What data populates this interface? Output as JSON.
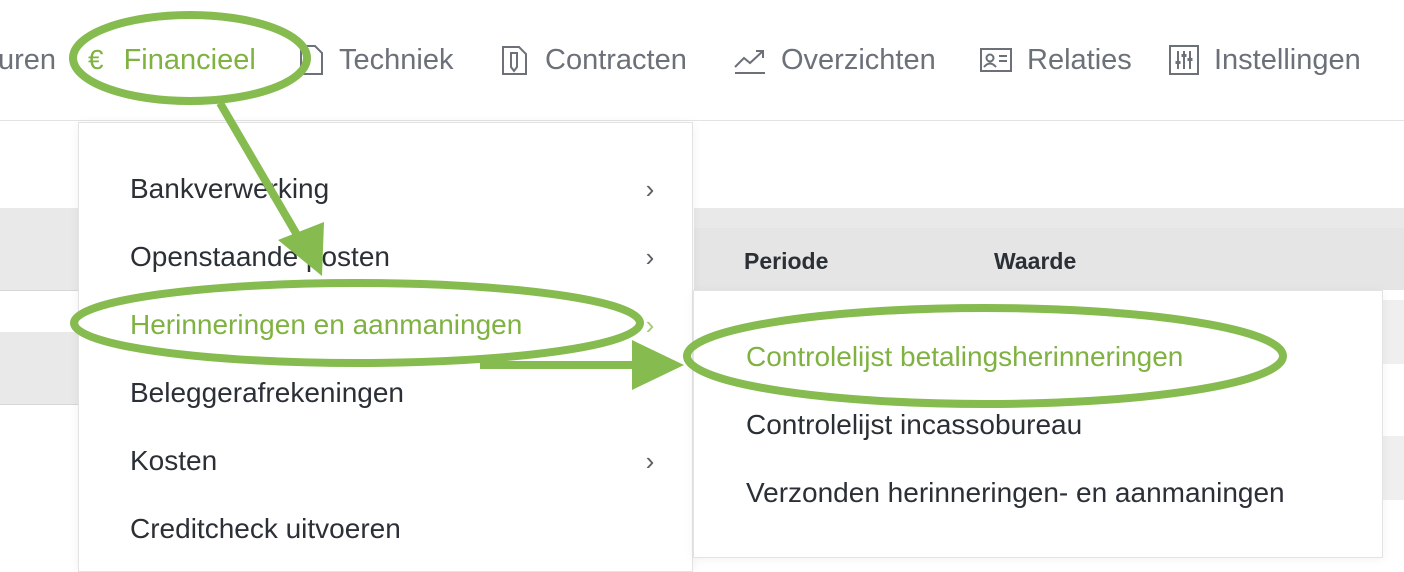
{
  "colors": {
    "accent": "#7fb241",
    "annotation": "#85bb4f",
    "nav_text": "#6b7079",
    "text": "#2b2f36"
  },
  "nav": {
    "items": [
      {
        "label": "uren",
        "icon": "none",
        "active": false
      },
      {
        "label": "Financieel",
        "icon": "euro-icon",
        "active": true
      },
      {
        "label": "Techniek",
        "icon": "document-icon",
        "active": false
      },
      {
        "label": "Contracten",
        "icon": "contract-icon",
        "active": false
      },
      {
        "label": "Overzichten",
        "icon": "trend-icon",
        "active": false
      },
      {
        "label": "Relaties",
        "icon": "id-card-icon",
        "active": false
      },
      {
        "label": "Instellingen",
        "icon": "sliders-icon",
        "active": false
      }
    ]
  },
  "table": {
    "columns": [
      "Periode",
      "Waarde"
    ]
  },
  "menu": {
    "items": [
      {
        "label": "Bankverwerking",
        "has_submenu": true
      },
      {
        "label": "Openstaande posten",
        "has_submenu": true
      },
      {
        "label": "Herinneringen en aanmaningen",
        "has_submenu": true,
        "active": true
      },
      {
        "label": "Beleggerafrekeningen",
        "has_submenu": false
      },
      {
        "label": "Kosten",
        "has_submenu": true
      },
      {
        "label": "Creditcheck uitvoeren",
        "has_submenu": false
      }
    ],
    "chevron": "›"
  },
  "submenu": {
    "items": [
      {
        "label": "Controlelijst betalingsherinneringen",
        "active": true
      },
      {
        "label": "Controlelijst incassobureau"
      },
      {
        "label": "Verzonden herinneringen- en aanmaningen"
      }
    ]
  }
}
